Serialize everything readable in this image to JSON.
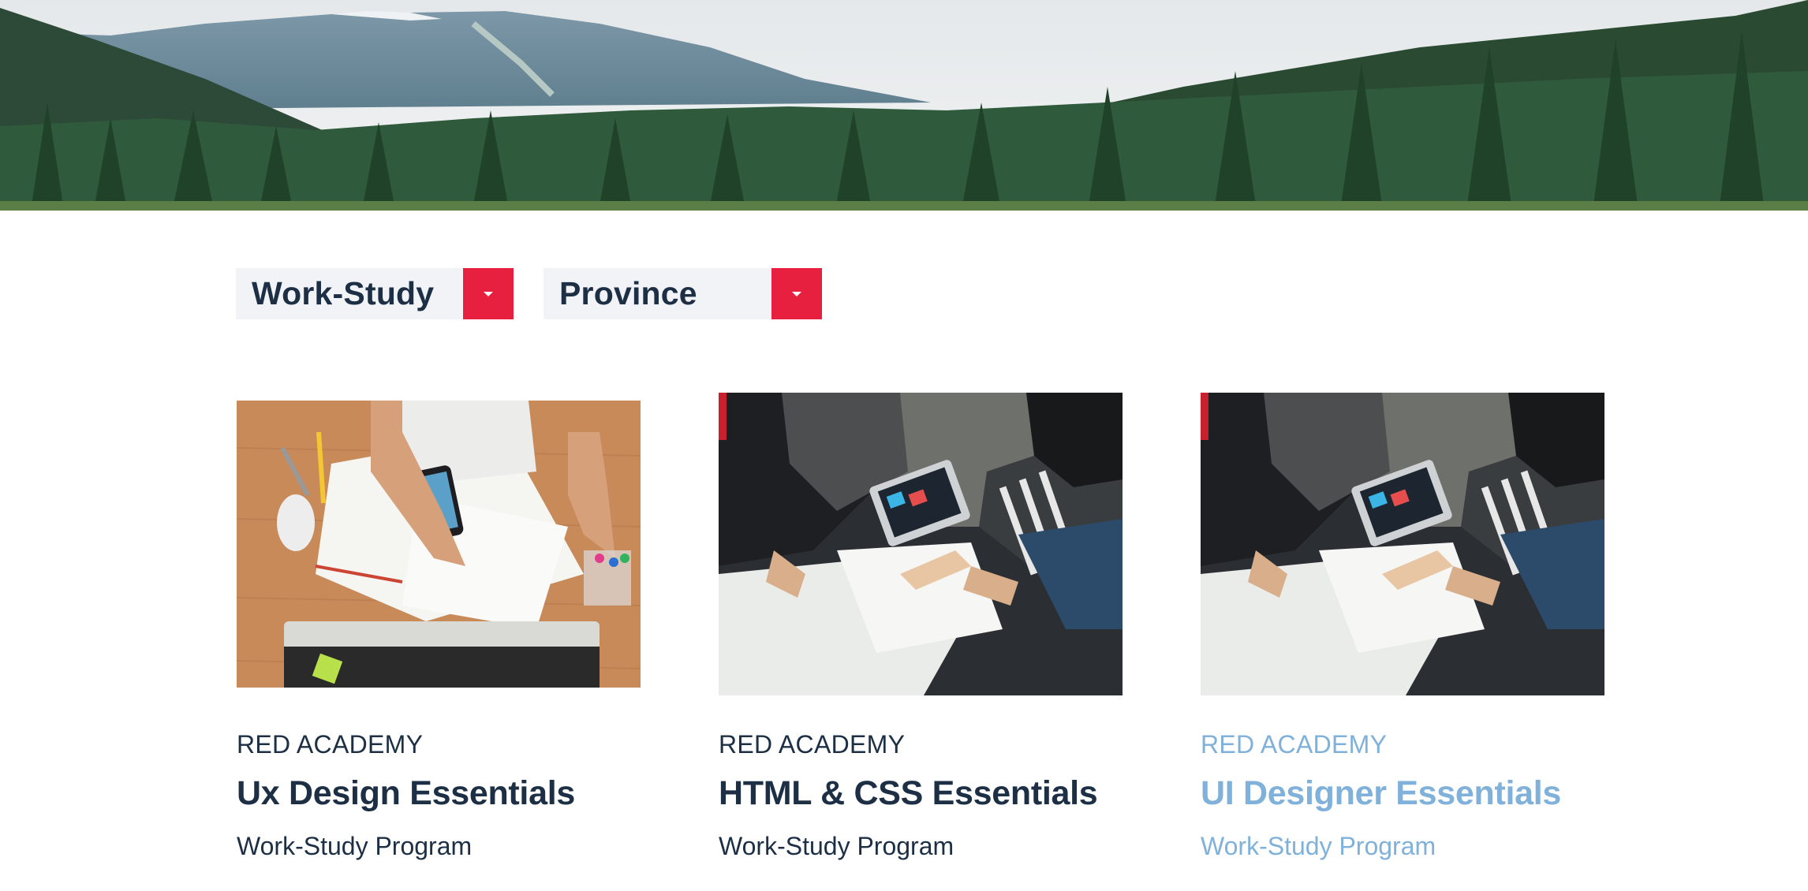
{
  "filters": {
    "program": {
      "label": "Work-Study",
      "icon": "caret-down-icon"
    },
    "province": {
      "label": "Province",
      "icon": "caret-down-icon"
    }
  },
  "colors": {
    "accent": "#e7203f",
    "text": "#1c2f44",
    "active_text": "#7fb1da",
    "filter_bg": "#f2f3f7"
  },
  "courses": [
    {
      "org": "RED ACADEMY",
      "title": "Ux Design Essentials",
      "subtitle": "Work-Study Program",
      "image": "ux-design-desk-photo"
    },
    {
      "org": "RED ACADEMY",
      "title": "HTML & CSS Essentials",
      "subtitle": "Work-Study Program",
      "image": "team-meeting-photo"
    },
    {
      "org": "RED ACADEMY",
      "title": "UI Designer Essentials",
      "subtitle": "Work-Study Program",
      "image": "team-meeting-photo",
      "state": "hovered"
    }
  ]
}
